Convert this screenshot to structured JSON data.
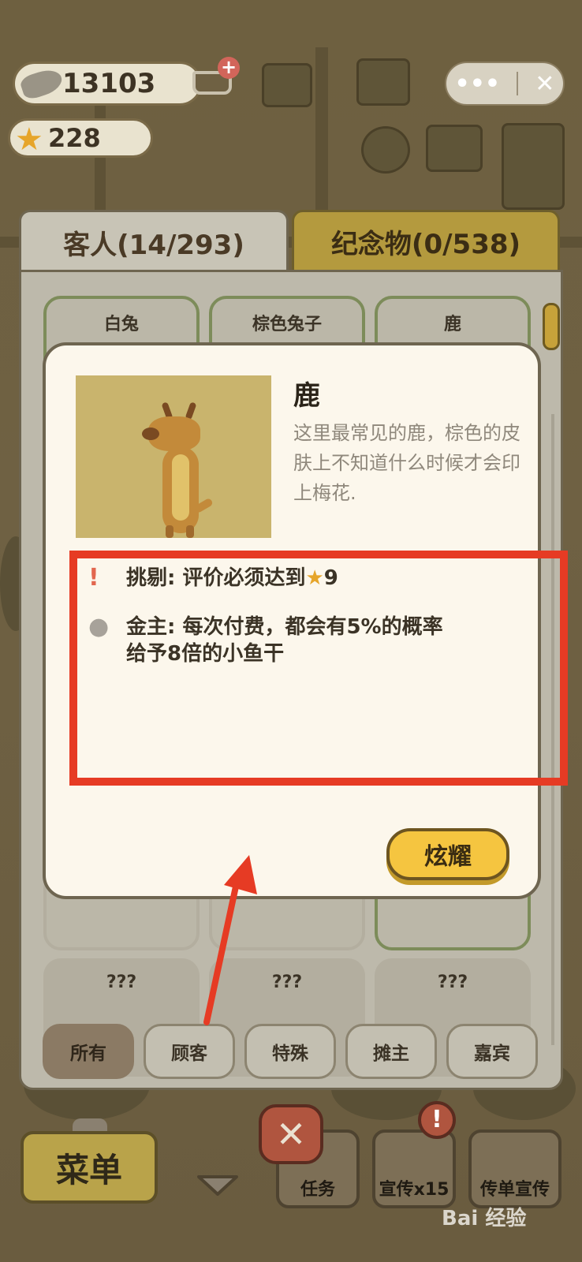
{
  "currency": {
    "fish": "13103",
    "stars": "228"
  },
  "tabs": {
    "guests": "客人(14/293)",
    "souvenirs": "纪念物(0/538)"
  },
  "grid": {
    "row1": [
      "白兔",
      "棕色兔子",
      "鹿"
    ],
    "row3": [
      "???",
      "???",
      "???"
    ]
  },
  "filters": [
    "所有",
    "顾客",
    "特殊",
    "摊主",
    "嘉宾"
  ],
  "modal": {
    "name": "鹿",
    "description": "这里最常见的鹿，棕色的皮肤上不知道什么时候才会印上梅花.",
    "trait1": "挑剔: 评价必须达到",
    "trait1_value": "9",
    "trait2_line1": "金主: 每次付费，都会有5%的概率",
    "trait2_line2": "给予8倍的小鱼干",
    "show_button": "炫耀"
  },
  "bottom": {
    "menu": "菜单",
    "tasks": "任务",
    "promo": "宣传x15",
    "flyer": "传单宣传"
  },
  "colors": {
    "highlight": "#e63b24",
    "accent_button": "#f5c540"
  }
}
